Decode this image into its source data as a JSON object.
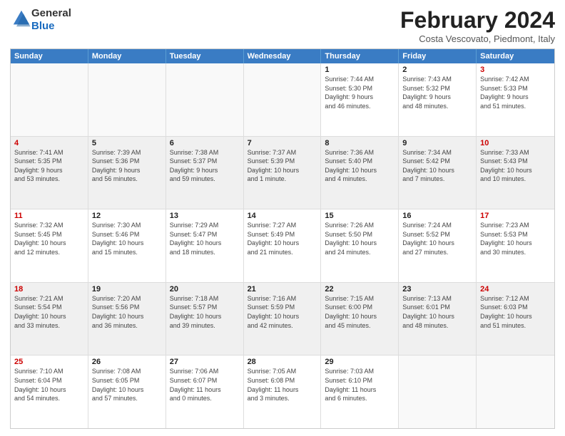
{
  "logo": {
    "general": "General",
    "blue": "Blue"
  },
  "header": {
    "month": "February 2024",
    "location": "Costa Vescovato, Piedmont, Italy"
  },
  "weekdays": [
    "Sunday",
    "Monday",
    "Tuesday",
    "Wednesday",
    "Thursday",
    "Friday",
    "Saturday"
  ],
  "rows": [
    [
      {
        "day": "",
        "info": ""
      },
      {
        "day": "",
        "info": ""
      },
      {
        "day": "",
        "info": ""
      },
      {
        "day": "",
        "info": ""
      },
      {
        "day": "1",
        "info": "Sunrise: 7:44 AM\nSunset: 5:30 PM\nDaylight: 9 hours\nand 46 minutes."
      },
      {
        "day": "2",
        "info": "Sunrise: 7:43 AM\nSunset: 5:32 PM\nDaylight: 9 hours\nand 48 minutes."
      },
      {
        "day": "3",
        "info": "Sunrise: 7:42 AM\nSunset: 5:33 PM\nDaylight: 9 hours\nand 51 minutes."
      }
    ],
    [
      {
        "day": "4",
        "info": "Sunrise: 7:41 AM\nSunset: 5:35 PM\nDaylight: 9 hours\nand 53 minutes."
      },
      {
        "day": "5",
        "info": "Sunrise: 7:39 AM\nSunset: 5:36 PM\nDaylight: 9 hours\nand 56 minutes."
      },
      {
        "day": "6",
        "info": "Sunrise: 7:38 AM\nSunset: 5:37 PM\nDaylight: 9 hours\nand 59 minutes."
      },
      {
        "day": "7",
        "info": "Sunrise: 7:37 AM\nSunset: 5:39 PM\nDaylight: 10 hours\nand 1 minute."
      },
      {
        "day": "8",
        "info": "Sunrise: 7:36 AM\nSunset: 5:40 PM\nDaylight: 10 hours\nand 4 minutes."
      },
      {
        "day": "9",
        "info": "Sunrise: 7:34 AM\nSunset: 5:42 PM\nDaylight: 10 hours\nand 7 minutes."
      },
      {
        "day": "10",
        "info": "Sunrise: 7:33 AM\nSunset: 5:43 PM\nDaylight: 10 hours\nand 10 minutes."
      }
    ],
    [
      {
        "day": "11",
        "info": "Sunrise: 7:32 AM\nSunset: 5:45 PM\nDaylight: 10 hours\nand 12 minutes."
      },
      {
        "day": "12",
        "info": "Sunrise: 7:30 AM\nSunset: 5:46 PM\nDaylight: 10 hours\nand 15 minutes."
      },
      {
        "day": "13",
        "info": "Sunrise: 7:29 AM\nSunset: 5:47 PM\nDaylight: 10 hours\nand 18 minutes."
      },
      {
        "day": "14",
        "info": "Sunrise: 7:27 AM\nSunset: 5:49 PM\nDaylight: 10 hours\nand 21 minutes."
      },
      {
        "day": "15",
        "info": "Sunrise: 7:26 AM\nSunset: 5:50 PM\nDaylight: 10 hours\nand 24 minutes."
      },
      {
        "day": "16",
        "info": "Sunrise: 7:24 AM\nSunset: 5:52 PM\nDaylight: 10 hours\nand 27 minutes."
      },
      {
        "day": "17",
        "info": "Sunrise: 7:23 AM\nSunset: 5:53 PM\nDaylight: 10 hours\nand 30 minutes."
      }
    ],
    [
      {
        "day": "18",
        "info": "Sunrise: 7:21 AM\nSunset: 5:54 PM\nDaylight: 10 hours\nand 33 minutes."
      },
      {
        "day": "19",
        "info": "Sunrise: 7:20 AM\nSunset: 5:56 PM\nDaylight: 10 hours\nand 36 minutes."
      },
      {
        "day": "20",
        "info": "Sunrise: 7:18 AM\nSunset: 5:57 PM\nDaylight: 10 hours\nand 39 minutes."
      },
      {
        "day": "21",
        "info": "Sunrise: 7:16 AM\nSunset: 5:59 PM\nDaylight: 10 hours\nand 42 minutes."
      },
      {
        "day": "22",
        "info": "Sunrise: 7:15 AM\nSunset: 6:00 PM\nDaylight: 10 hours\nand 45 minutes."
      },
      {
        "day": "23",
        "info": "Sunrise: 7:13 AM\nSunset: 6:01 PM\nDaylight: 10 hours\nand 48 minutes."
      },
      {
        "day": "24",
        "info": "Sunrise: 7:12 AM\nSunset: 6:03 PM\nDaylight: 10 hours\nand 51 minutes."
      }
    ],
    [
      {
        "day": "25",
        "info": "Sunrise: 7:10 AM\nSunset: 6:04 PM\nDaylight: 10 hours\nand 54 minutes."
      },
      {
        "day": "26",
        "info": "Sunrise: 7:08 AM\nSunset: 6:05 PM\nDaylight: 10 hours\nand 57 minutes."
      },
      {
        "day": "27",
        "info": "Sunrise: 7:06 AM\nSunset: 6:07 PM\nDaylight: 11 hours\nand 0 minutes."
      },
      {
        "day": "28",
        "info": "Sunrise: 7:05 AM\nSunset: 6:08 PM\nDaylight: 11 hours\nand 3 minutes."
      },
      {
        "day": "29",
        "info": "Sunrise: 7:03 AM\nSunset: 6:10 PM\nDaylight: 11 hours\nand 6 minutes."
      },
      {
        "day": "",
        "info": ""
      },
      {
        "day": "",
        "info": ""
      }
    ]
  ]
}
